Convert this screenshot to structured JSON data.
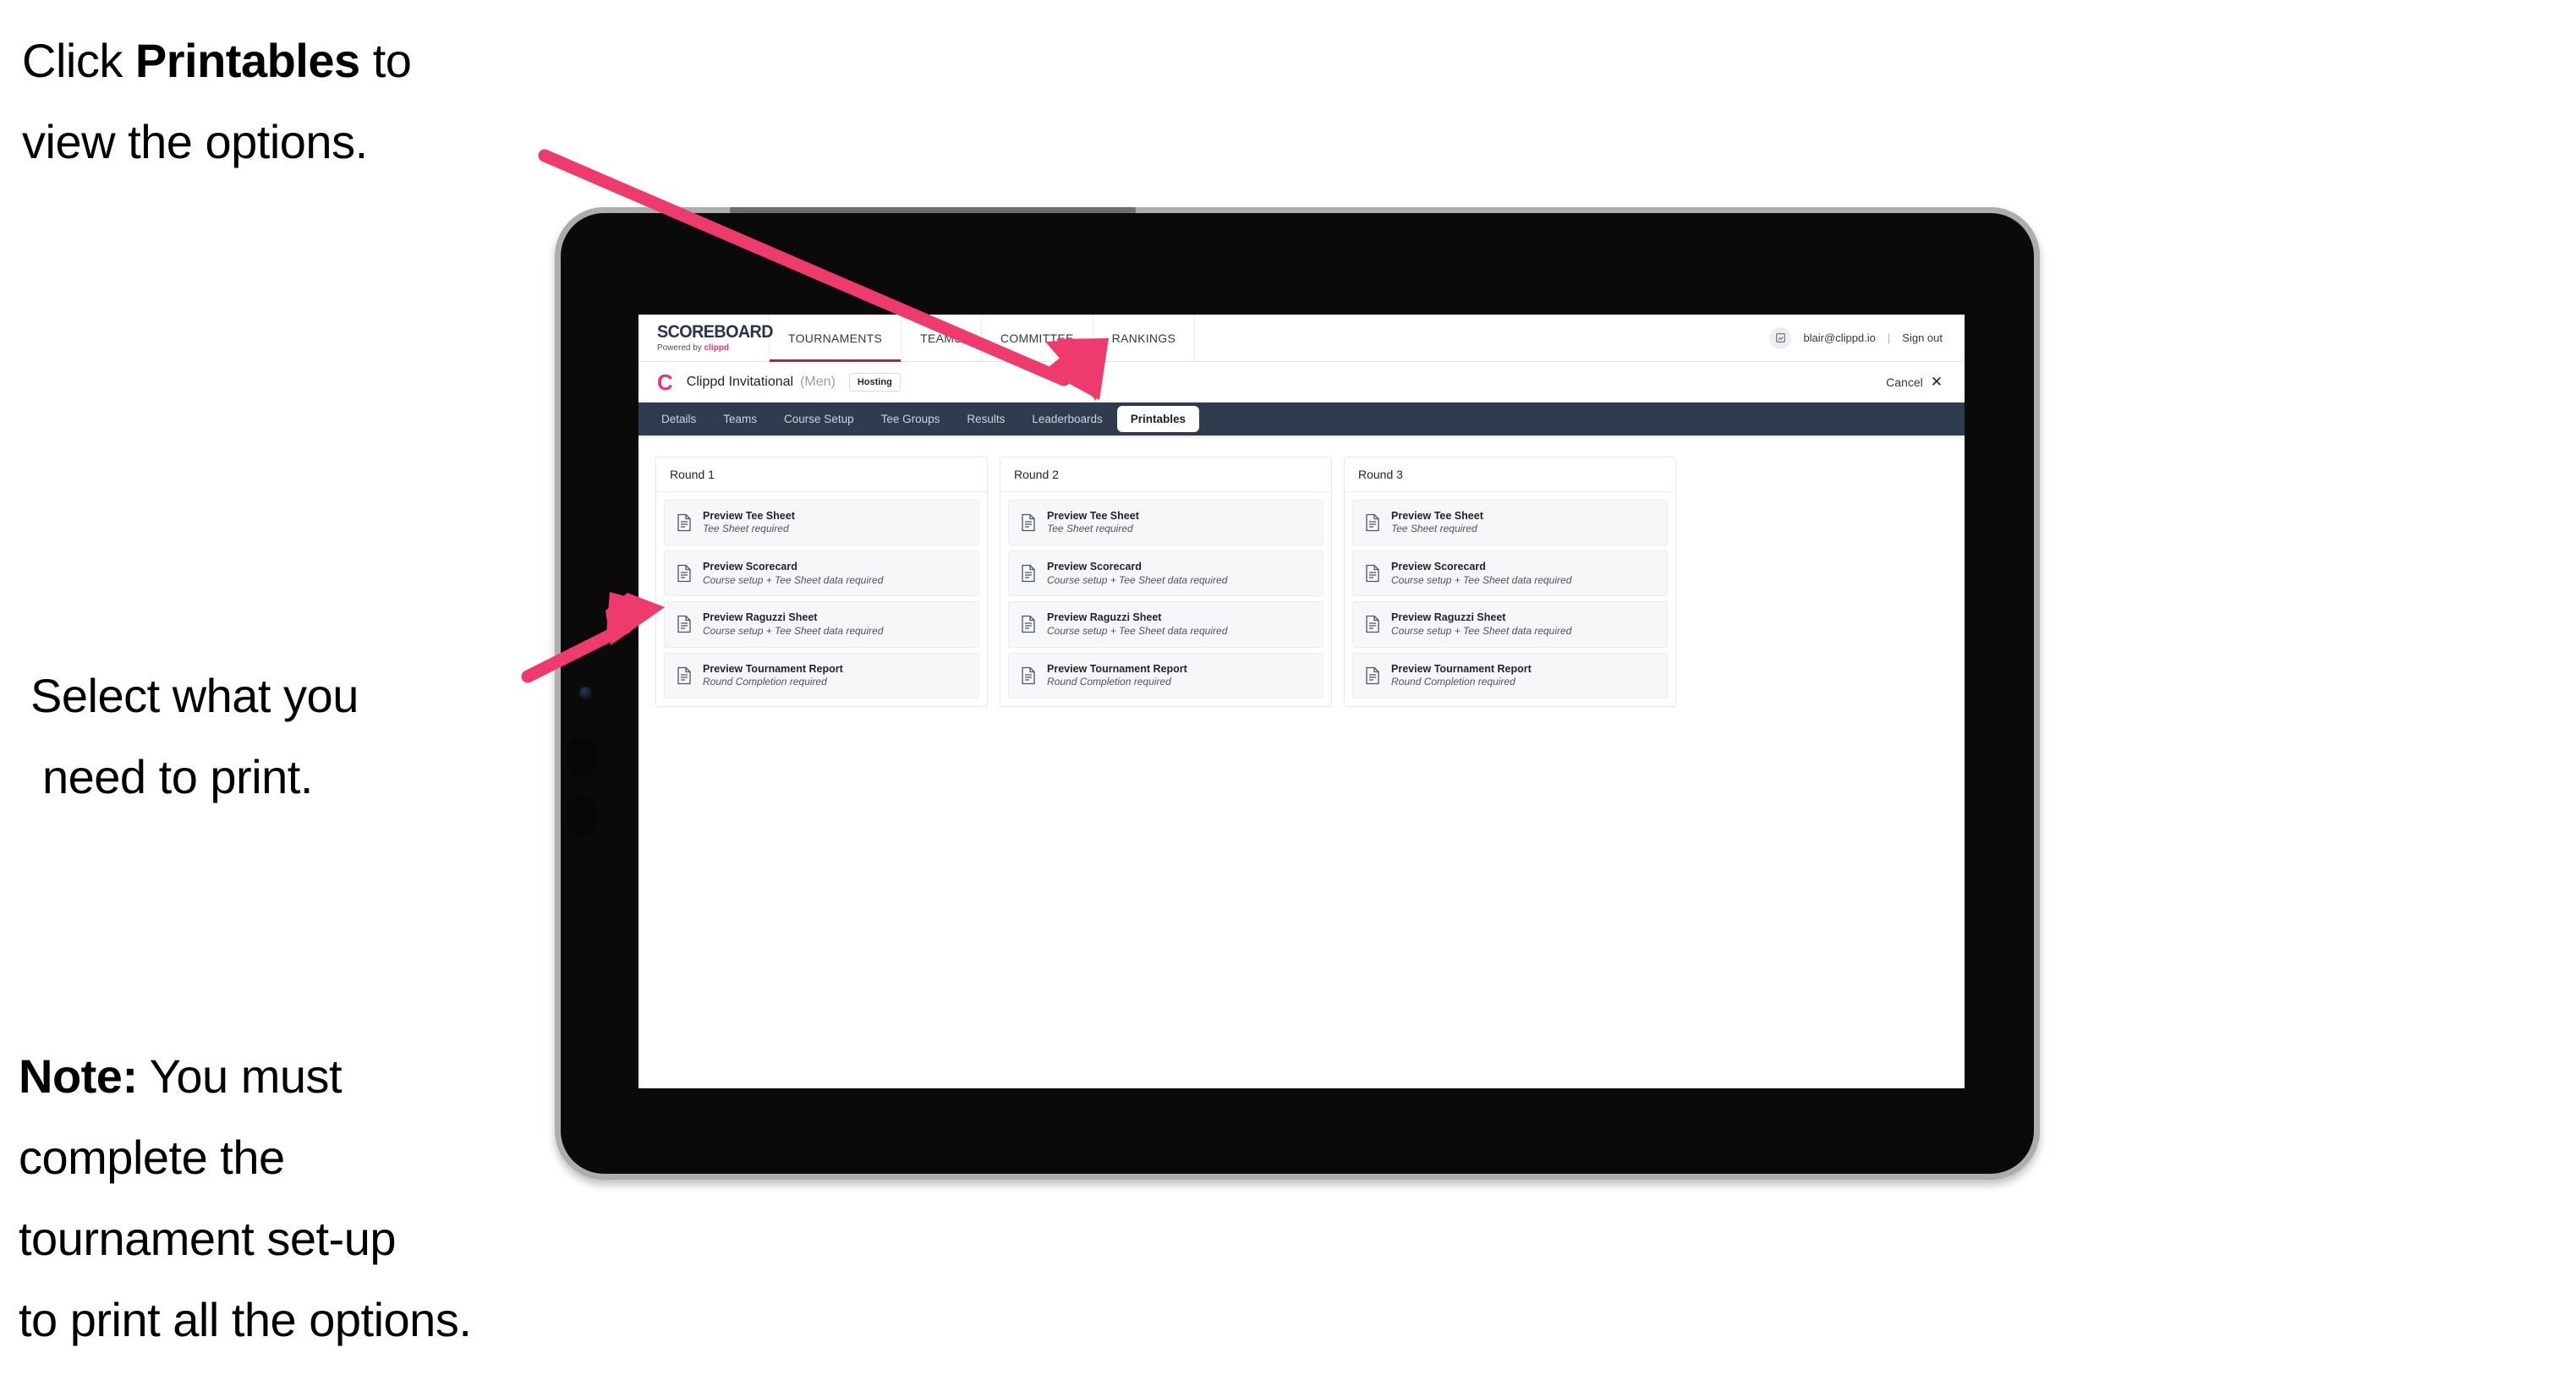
{
  "annotations": {
    "top": {
      "pre": "Click ",
      "bold": "Printables",
      "post": " to",
      "line2": "view the options."
    },
    "middle": {
      "line1": "Select what you",
      "line2": "need to print."
    },
    "note": {
      "bold": "Note:",
      "rest": " You must",
      "line2": "complete the",
      "line3": "tournament set-up",
      "line4": "to print all the options."
    },
    "arrow_color": "#ef3a6e"
  },
  "app": {
    "brand": {
      "title": "SCOREBOARD",
      "powered_prefix": "Powered by ",
      "powered_brand": "clippd"
    },
    "top_nav": [
      {
        "label": "TOURNAMENTS",
        "active": true
      },
      {
        "label": "TEAMS",
        "active": false
      },
      {
        "label": "COMMITTEE",
        "active": false
      },
      {
        "label": "RANKINGS",
        "active": false
      }
    ],
    "account": {
      "avatar_icon": "user-avatar-icon",
      "email": "blair@clippd.io",
      "divider": "|",
      "sign_out": "Sign out"
    },
    "tournament": {
      "logo_letter": "C",
      "name": "Clippd Invitational",
      "gender": "(Men)",
      "badge": "Hosting",
      "cancel_label": "Cancel",
      "cancel_icon": "close-x-icon"
    },
    "tabs": [
      {
        "label": "Details",
        "active": false
      },
      {
        "label": "Teams",
        "active": false
      },
      {
        "label": "Course Setup",
        "active": false
      },
      {
        "label": "Tee Groups",
        "active": false
      },
      {
        "label": "Results",
        "active": false
      },
      {
        "label": "Leaderboards",
        "active": false
      },
      {
        "label": "Printables",
        "active": true
      }
    ],
    "rounds": [
      {
        "title": "Round 1",
        "items": [
          {
            "title": "Preview Tee Sheet",
            "sub": "Tee Sheet required",
            "icon": "document-icon"
          },
          {
            "title": "Preview Scorecard",
            "sub": "Course setup + Tee Sheet data required",
            "icon": "document-icon"
          },
          {
            "title": "Preview Raguzzi Sheet",
            "sub": "Course setup + Tee Sheet data required",
            "icon": "document-icon"
          },
          {
            "title": "Preview Tournament Report",
            "sub": "Round Completion required",
            "icon": "document-icon"
          }
        ]
      },
      {
        "title": "Round 2",
        "items": [
          {
            "title": "Preview Tee Sheet",
            "sub": "Tee Sheet required",
            "icon": "document-icon"
          },
          {
            "title": "Preview Scorecard",
            "sub": "Course setup + Tee Sheet data required",
            "icon": "document-icon"
          },
          {
            "title": "Preview Raguzzi Sheet",
            "sub": "Course setup + Tee Sheet data required",
            "icon": "document-icon"
          },
          {
            "title": "Preview Tournament Report",
            "sub": "Round Completion required",
            "icon": "document-icon"
          }
        ]
      },
      {
        "title": "Round 3",
        "items": [
          {
            "title": "Preview Tee Sheet",
            "sub": "Tee Sheet required",
            "icon": "document-icon"
          },
          {
            "title": "Preview Scorecard",
            "sub": "Course setup + Tee Sheet data required",
            "icon": "document-icon"
          },
          {
            "title": "Preview Raguzzi Sheet",
            "sub": "Course setup + Tee Sheet data required",
            "icon": "document-icon"
          },
          {
            "title": "Preview Tournament Report",
            "sub": "Round Completion required",
            "icon": "document-icon"
          }
        ]
      }
    ]
  },
  "colors": {
    "accent_pink": "#e6356f",
    "tabstrip_bg": "#2f3b4f",
    "nav_underline": "#9e2850"
  }
}
